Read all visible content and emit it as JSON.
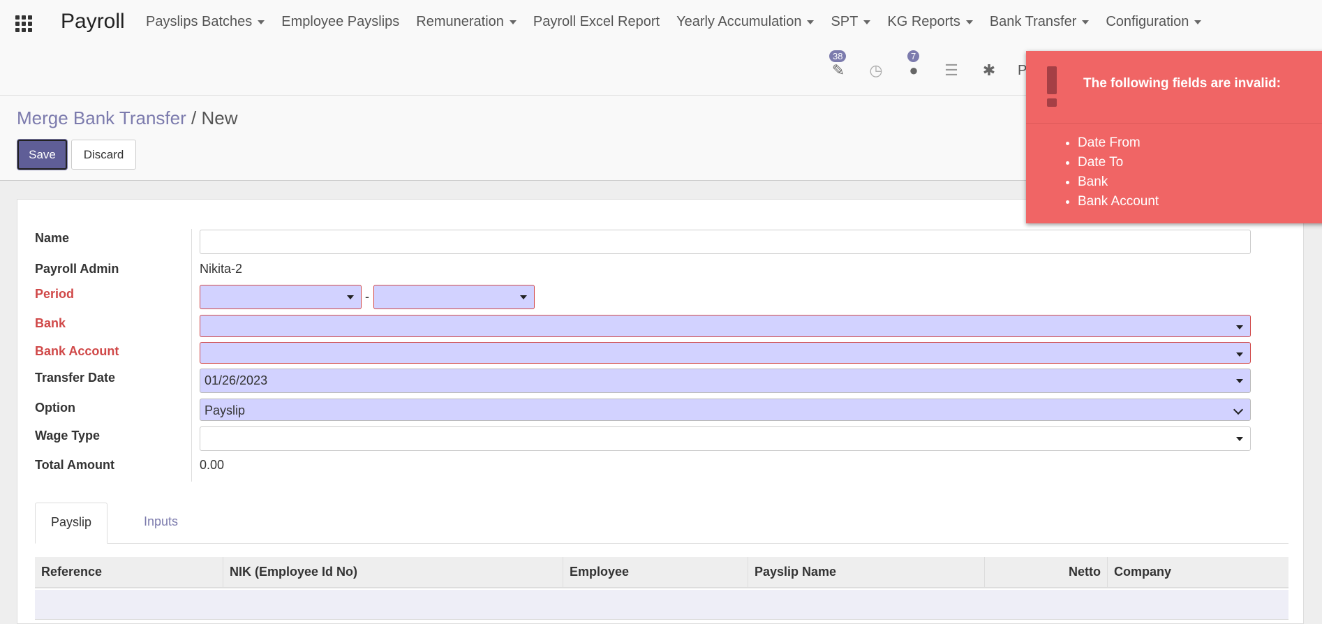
{
  "nav": {
    "app_title": "Payroll",
    "menu": [
      {
        "label": "Payslips Batches",
        "dropdown": true
      },
      {
        "label": "Employee Payslips",
        "dropdown": false
      },
      {
        "label": "Remuneration",
        "dropdown": true
      },
      {
        "label": "Payroll Excel Report",
        "dropdown": false
      },
      {
        "label": "Yearly Accumulation",
        "dropdown": true
      },
      {
        "label": "SPT",
        "dropdown": true
      },
      {
        "label": "KG Reports",
        "dropdown": true
      },
      {
        "label": "Bank Transfer",
        "dropdown": true
      },
      {
        "label": "Configuration",
        "dropdown": true
      }
    ],
    "activities_count": "38",
    "messages_count": "7",
    "company": "PT. S"
  },
  "breadcrumb": {
    "parent": "Merge Bank Transfer",
    "separator": "/",
    "current": "New"
  },
  "buttons": {
    "save": "Save",
    "discard": "Discard"
  },
  "form": {
    "name": {
      "label": "Name",
      "value": ""
    },
    "payroll_admin": {
      "label": "Payroll Admin",
      "value": "Nikita-2"
    },
    "period": {
      "label": "Period",
      "from": "",
      "separator": "-",
      "to": ""
    },
    "bank": {
      "label": "Bank",
      "value": ""
    },
    "bank_account": {
      "label": "Bank Account",
      "value": ""
    },
    "transfer_date": {
      "label": "Transfer Date",
      "value": "01/26/2023"
    },
    "option": {
      "label": "Option",
      "value": "Payslip"
    },
    "wage_type": {
      "label": "Wage Type",
      "value": ""
    },
    "total_amount": {
      "label": "Total Amount",
      "value": "0.00"
    }
  },
  "tabs": [
    {
      "label": "Payslip",
      "active": true
    },
    {
      "label": "Inputs",
      "active": false
    }
  ],
  "table": {
    "columns": [
      "Reference",
      "NIK (Employee Id No)",
      "Employee",
      "Payslip Name",
      "Netto",
      "Company"
    ],
    "rows": []
  },
  "notification": {
    "title": "The following fields are invalid:",
    "items": [
      "Date From",
      "Date To",
      "Bank",
      "Bank Account"
    ],
    "color": "#f06565"
  },
  "colors": {
    "accent": "#7c7bad",
    "required": "#d04848",
    "primary_button": "#5f5e97"
  }
}
